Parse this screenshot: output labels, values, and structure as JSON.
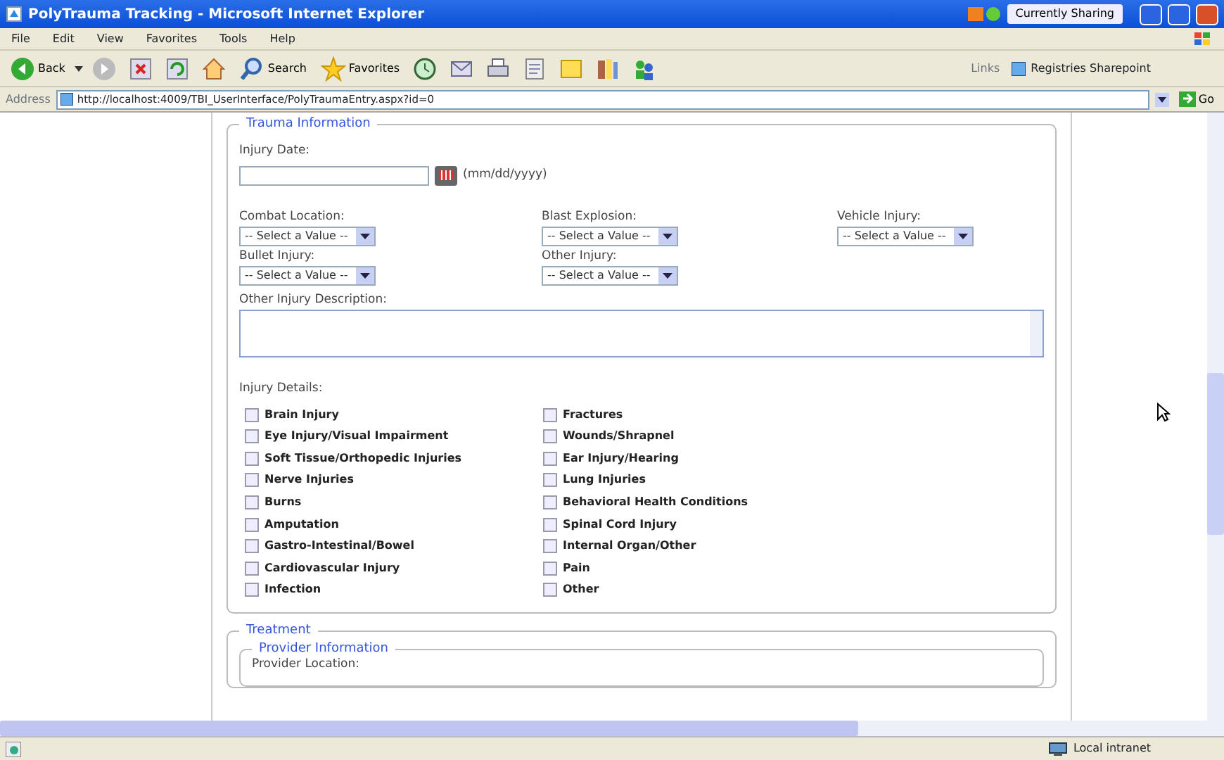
{
  "window": {
    "title": "PolyTrauma Tracking - Microsoft Internet Explorer",
    "sharing": "Currently Sharing"
  },
  "menu": [
    "File",
    "Edit",
    "View",
    "Favorites",
    "Tools",
    "Help"
  ],
  "toolbar": [
    {
      "kind": "back",
      "label": "Back"
    },
    {
      "kind": "forward"
    },
    {
      "kind": "stop"
    },
    {
      "kind": "refresh"
    },
    {
      "kind": "home"
    },
    {
      "kind": "search",
      "label": "Search"
    },
    {
      "kind": "favorites",
      "label": "Favorites"
    },
    {
      "kind": "history"
    },
    {
      "kind": "mail"
    },
    {
      "kind": "print"
    },
    {
      "kind": "edit"
    },
    {
      "kind": "note"
    },
    {
      "kind": "research"
    },
    {
      "kind": "messenger"
    }
  ],
  "links": {
    "label": "Links",
    "items": [
      "Registries Sharepoint"
    ]
  },
  "address": {
    "label": "Address",
    "url": "http://localhost:4009/TBI_UserInterface/PolyTraumaEntry.aspx?id=0",
    "go": "Go"
  },
  "trauma": {
    "legend": "Trauma Information",
    "date_label": "Injury Date:",
    "date_format": "(mm/dd/yyyy)",
    "selects": [
      {
        "label": "Combat Location:",
        "value": "-- Select a Value --"
      },
      {
        "label": "Blast Explosion:",
        "value": "-- Select a Value --"
      },
      {
        "label": "Vehicle Injury:",
        "value": "-- Select a Value --"
      },
      {
        "label": "Bullet Injury:",
        "value": "-- Select a Value --"
      },
      {
        "label": "Other Injury:",
        "value": "-- Select a Value --"
      }
    ],
    "description_label": "Other Injury Description:",
    "details_label": "Injury Details:",
    "injuries": [
      [
        {
          "label": "Brain Injury",
          "checked": false
        },
        {
          "label": "Eye Injury/Visual Impairment",
          "checked": false
        },
        {
          "label": "Soft Tissue/Orthopedic Injuries",
          "checked": false
        },
        {
          "label": "Nerve Injuries",
          "checked": false
        },
        {
          "label": "Burns",
          "checked": false
        },
        {
          "label": "Amputation",
          "checked": false
        },
        {
          "label": "Gastro-Intestinal/Bowel",
          "checked": false
        },
        {
          "label": "Cardiovascular Injury",
          "checked": false
        },
        {
          "label": "Infection",
          "checked": false
        }
      ],
      [
        {
          "label": "Fractures",
          "checked": false
        },
        {
          "label": "Wounds/Shrapnel",
          "checked": false
        },
        {
          "label": "Ear Injury/Hearing",
          "checked": false
        },
        {
          "label": "Lung Injuries",
          "checked": false
        },
        {
          "label": "Behavioral Health Conditions",
          "checked": false
        },
        {
          "label": "Spinal Cord Injury",
          "checked": false
        },
        {
          "label": "Internal Organ/Other",
          "checked": false
        },
        {
          "label": "Pain",
          "checked": false
        },
        {
          "label": "Other",
          "checked": false
        }
      ]
    ]
  },
  "treatment": {
    "legend": "Treatment",
    "provider_legend": "Provider Information",
    "provider_field": "Provider Location:"
  },
  "status_bar": {
    "zone": "Local intranet"
  }
}
